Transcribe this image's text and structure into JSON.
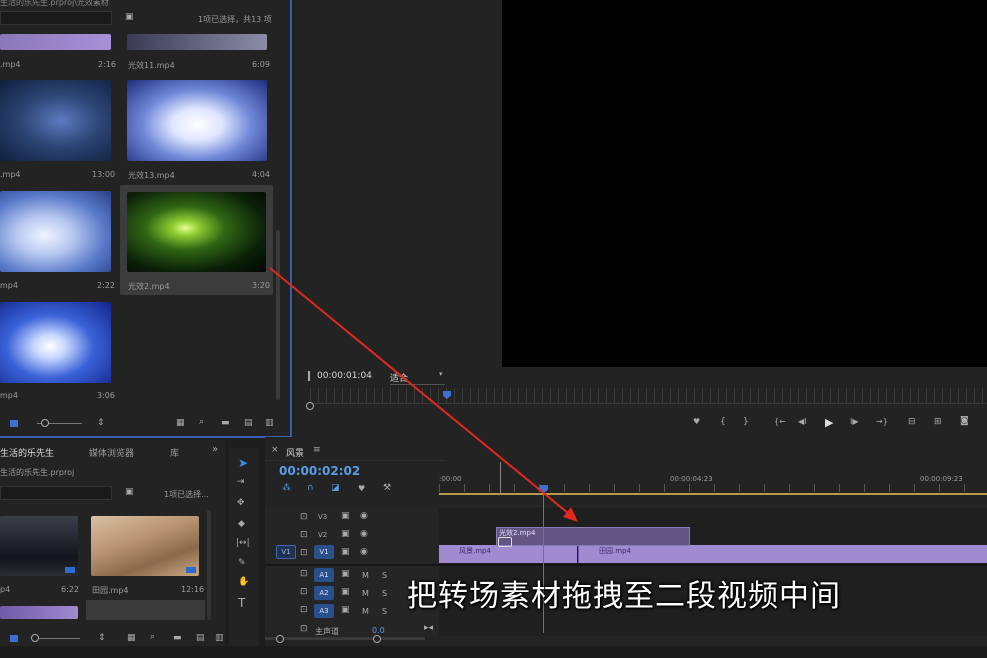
{
  "project_panel": {
    "title": "生活的乐先生.prproj\\光效素材",
    "selection_info": "1项已选择，共13 项",
    "clips": [
      {
        "name": ".mp4",
        "duration": "2:16"
      },
      {
        "name": "光效11.mp4",
        "duration": "6:09"
      },
      {
        "name": ".mp4",
        "duration": "13:00"
      },
      {
        "name": "光效13.mp4",
        "duration": "4:04"
      },
      {
        "name": "mp4",
        "duration": "2:22"
      },
      {
        "name": "光效2.mp4",
        "duration": "3:20"
      },
      {
        "name": "mp4",
        "duration": "3:06"
      }
    ]
  },
  "program_monitor": {
    "timecode": "00:00:01:04",
    "zoom": "适合"
  },
  "lower_project": {
    "tabs": [
      "生活的乐先生",
      "媒体浏览器",
      "库"
    ],
    "file": "生活的乐先生.prproj",
    "selection_info": "1项已选择...",
    "clips": [
      {
        "name": "p4",
        "duration": "6:22"
      },
      {
        "name": "田园.mp4",
        "duration": "12:16"
      }
    ]
  },
  "timeline": {
    "sequence": "风景",
    "timecode": "00:00:02:02",
    "ruler": [
      ":00:00",
      "00:00:04:23",
      "00:00:09:23"
    ],
    "tracks": {
      "video": [
        "V3",
        "V2",
        "V1"
      ],
      "audio": [
        "A1",
        "A2",
        "A3"
      ],
      "source": "V1",
      "master": "主声道",
      "master_value": "0.0"
    },
    "clips": {
      "dragged": "光效2.mp4",
      "v1_a": "风景.mp4",
      "v1_b": "田园.mp4"
    },
    "track_letters": {
      "mute": "M",
      "solo": "S"
    }
  },
  "subtitle": "把转场素材拖拽至二段视频中间",
  "icons": {
    "play": "▶",
    "step_back": "◀I",
    "step_fwd": "I▶",
    "mark_in": "{",
    "mark_out": "}",
    "marker": "♥",
    "go_in": "{←",
    "go_out": "→}",
    "camera": "◙",
    "lock": "🔒",
    "eye": "◉",
    "film": "▣",
    "chevrons": "»",
    "close": "×",
    "menu": "≡",
    "wrench": "🔧",
    "list_view": "▦",
    "search": "⌕",
    "folder": "▬",
    "trash": "▥"
  },
  "colors": {
    "accent": "#3b5fb0",
    "timecode": "#5b9ce6",
    "clip_purple": "#a08ad0",
    "annotation": "#e0281f"
  }
}
